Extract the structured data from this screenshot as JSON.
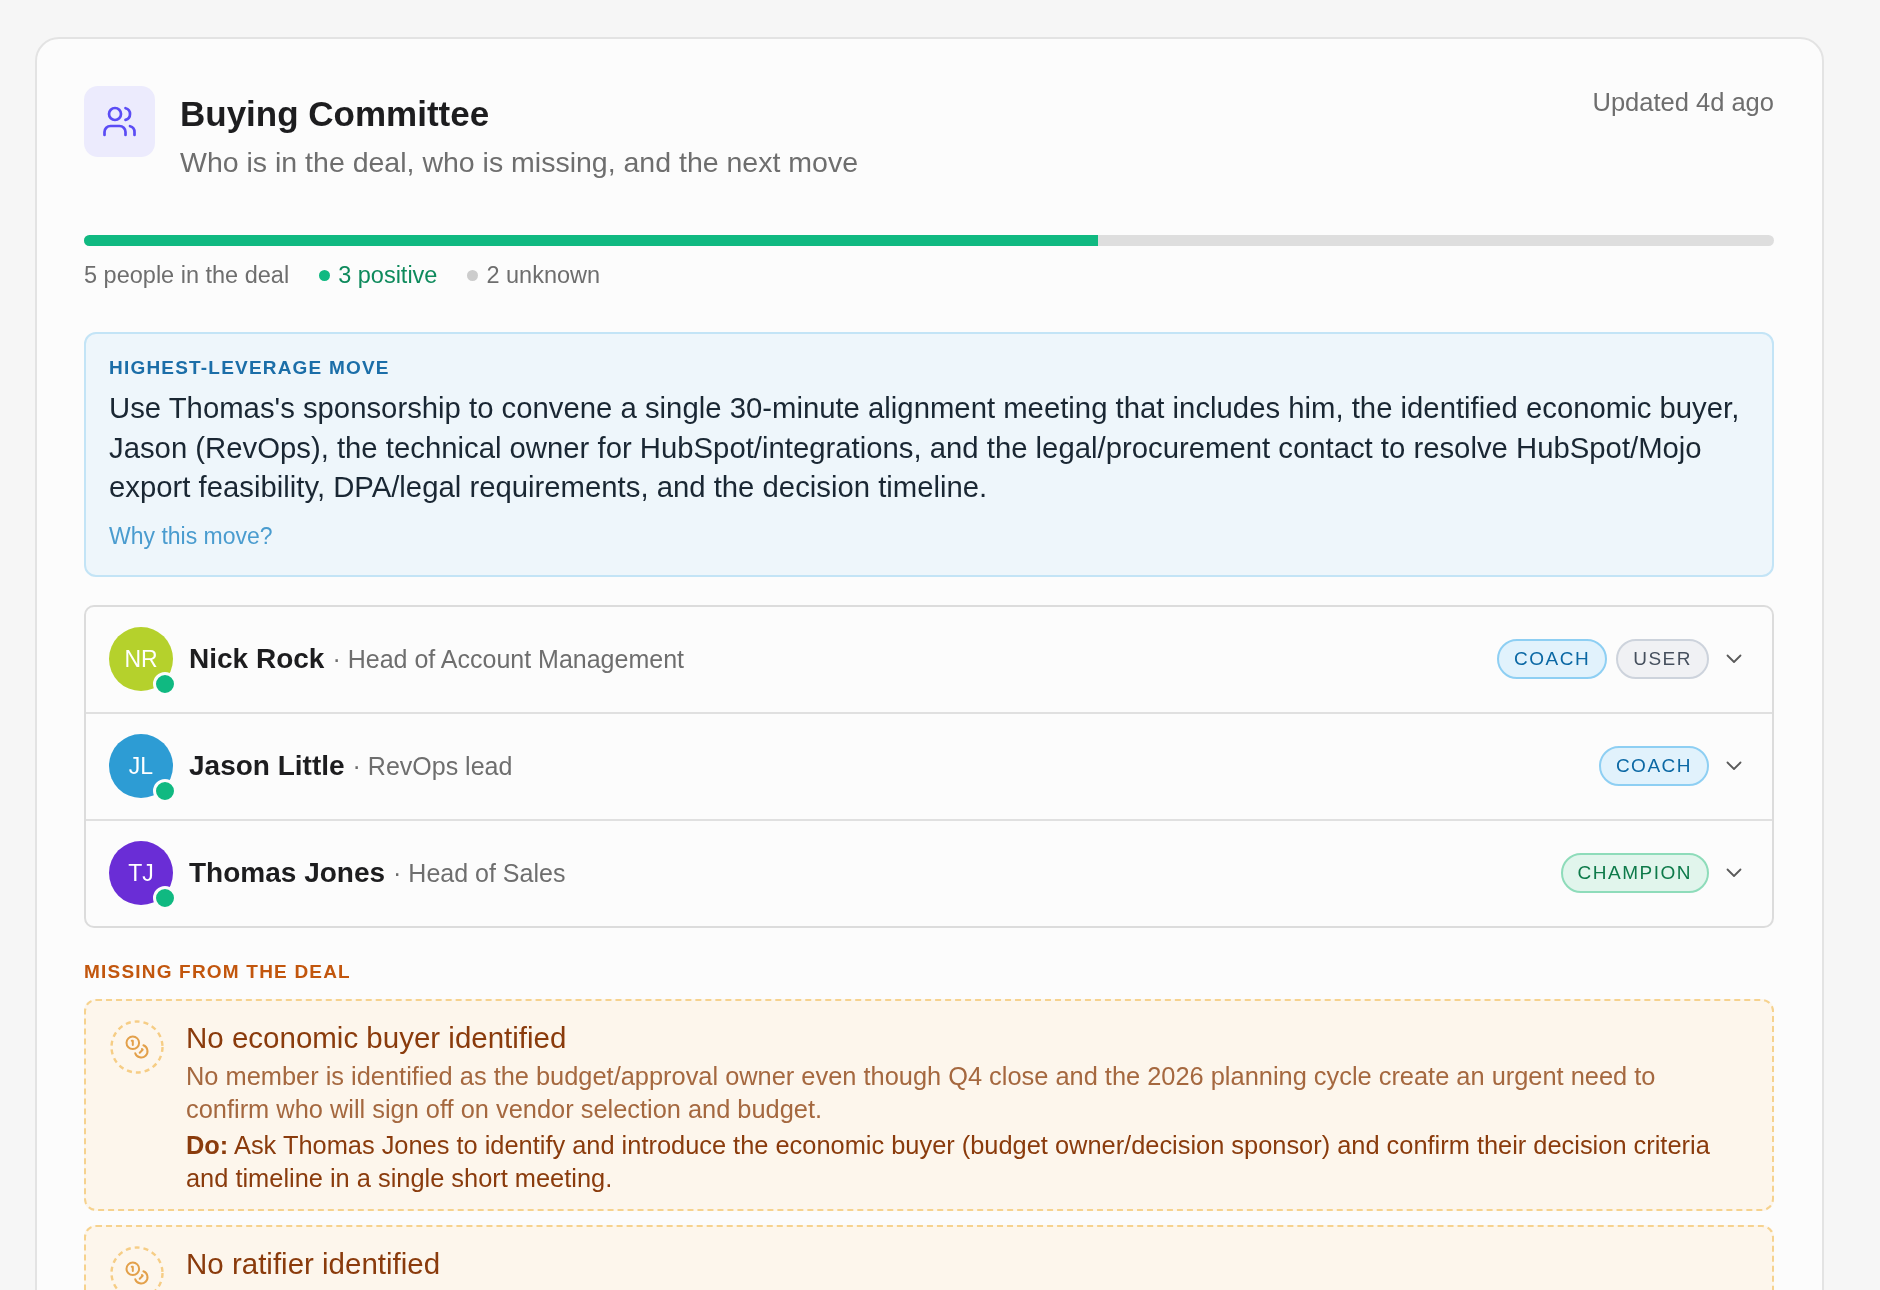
{
  "header": {
    "title": "Buying Committee",
    "subtitle": "Who is in the deal, who is missing, and the next move",
    "updated": "Updated 4d ago"
  },
  "progress": {
    "level": 0.6
  },
  "summary": {
    "total": "5 people in the deal",
    "segments": [
      {
        "label": "3 positive",
        "kind": "positive",
        "color": "#10b981"
      },
      {
        "label": "2 unknown",
        "kind": "unknown",
        "color": "#cccccc"
      }
    ]
  },
  "highest_leverage_move": {
    "label": "HIGHEST-LEVERAGE MOVE",
    "text": "Use Thomas's sponsorship to convene a single 30-minute alignment meeting that includes him, the identified economic buyer, Jason (RevOps), the technical owner for HubSpot/integrations, and the legal/procurement contact to resolve HubSpot/Mojo export feasibility, DPA/legal requirements, and the decision timeline.",
    "link": "Why this move?"
  },
  "members": [
    {
      "initials": "NR",
      "name": "Nick Rock",
      "role": "· Head of Account Management",
      "color": "#b5d12c",
      "positive": true,
      "tags": [
        {
          "label": "COACH",
          "kind": "coach"
        },
        {
          "label": "USER",
          "kind": "user"
        }
      ],
      "expanded": false
    },
    {
      "initials": "JL",
      "name": "Jason Little",
      "role": "· RevOps lead",
      "color": "#2d9cd4",
      "positive": true,
      "tags": [
        {
          "label": "COACH",
          "kind": "coach"
        }
      ],
      "expanded": false
    },
    {
      "initials": "TJ",
      "name": "Thomas Jones",
      "role": "· Head of Sales",
      "color": "#6a2dd6",
      "positive": true,
      "tags": [
        {
          "label": "CHAMPION",
          "kind": "champion"
        }
      ],
      "expanded": false
    }
  ],
  "missing": {
    "label": "MISSING FROM THE DEAL",
    "gaps": [
      {
        "title": "No economic buyer identified",
        "description": "No member is identified as the budget/approval owner even though Q4 close and the 2026 planning cycle create an urgent need to confirm who will sign off on vendor selection and budget.",
        "action": "**Do:** Ask Thomas Jones to identify and introduce the economic buyer (budget owner/decision sponsor) and confirm their decision criteria and timeline in a single short meeting."
      },
      {
        "title": "No ratifier identified"
      }
    ]
  }
}
